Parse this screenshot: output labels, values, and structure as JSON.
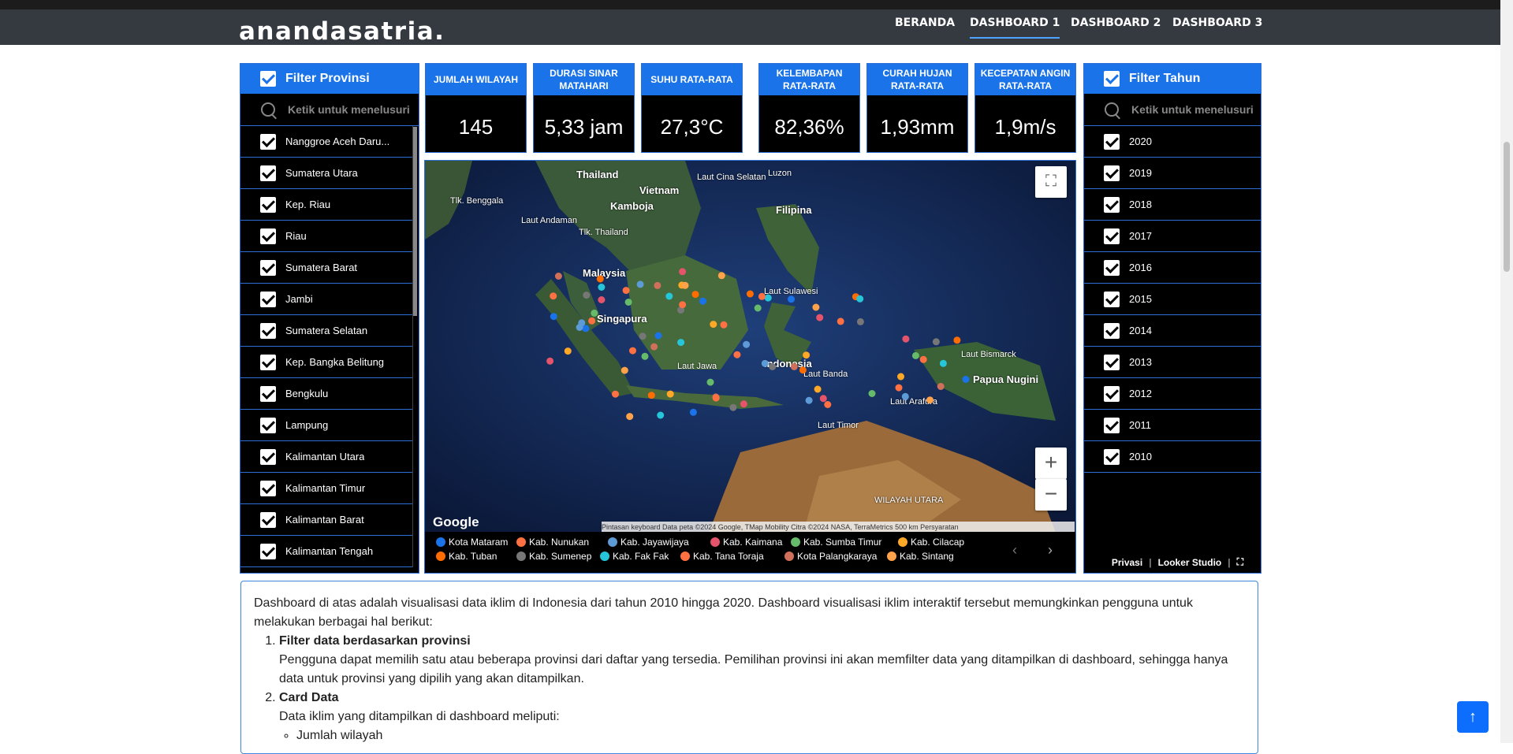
{
  "brand": "anandasatria.",
  "nav": [
    "BERANDA",
    "DASHBOARD 1",
    "DASHBOARD 2",
    "DASHBOARD 3"
  ],
  "filter_prov": {
    "title": "Filter Provinsi",
    "placeholder": "Ketik untuk menelusuri",
    "items": [
      "Nanggroe Aceh Daru...",
      "Sumatera Utara",
      "Kep. Riau",
      "Riau",
      "Sumatera Barat",
      "Jambi",
      "Sumatera Selatan",
      "Kep. Bangka Belitung",
      "Bengkulu",
      "Lampung",
      "Kalimantan Utara",
      "Kalimantan Timur",
      "Kalimantan Barat",
      "Kalimantan Tengah"
    ]
  },
  "filter_year": {
    "title": "Filter Tahun",
    "placeholder": "Ketik untuk menelusuri",
    "items": [
      "2020",
      "2019",
      "2018",
      "2017",
      "2016",
      "2015",
      "2014",
      "2013",
      "2012",
      "2011",
      "2010"
    ]
  },
  "cards": [
    {
      "label": "JUMLAH WILAYAH",
      "value": "145"
    },
    {
      "label": "DURASI SINAR MATAHARI",
      "value": "5,33 jam"
    },
    {
      "label": "SUHU RATA-RATA",
      "value": "27,3°C"
    },
    {
      "label": "KELEMBAPAN RATA-RATA",
      "value": "82,36%"
    },
    {
      "label": "CURAH HUJAN RATA-RATA",
      "value": "1,93mm"
    },
    {
      "label": "KECEPATAN ANGIN RATA-RATA",
      "value": "1,9m/s"
    }
  ],
  "map": {
    "labels": [
      "Thailand",
      "Vietnam",
      "Kamboja",
      "Laut Cina Selatan",
      "Tlk. Benggala",
      "Luzon",
      "Filipina",
      "Laut Andaman",
      "Tlk. Thailand",
      "Malaysia",
      "Singapura",
      "Laut Sulawesi",
      "Indonesia",
      "Laut Jawa",
      "Laut Banda",
      "Laut Bismarck",
      "Papua Nugini",
      "Laut Arafura",
      "Laut Timor",
      "WILAYAH UTARA"
    ],
    "google": "Google",
    "attribution": "Pintasan keyboard   Data peta ©2024 Google, TMap Mobility Citra ©2024 NASA, TerraMetrics   500 km   Persyaratan",
    "zoom_in": "+",
    "zoom_out": "−"
  },
  "legend": [
    {
      "name": "Kota Mataram",
      "color": "#1a73e8"
    },
    {
      "name": "Kab. Nunukan",
      "color": "#ff7043"
    },
    {
      "name": "Kab. Jayawijaya",
      "color": "#5c9bd6"
    },
    {
      "name": "Kab. Kaimana",
      "color": "#e5546b"
    },
    {
      "name": "Kab. Sumba Timur",
      "color": "#66bb6a"
    },
    {
      "name": "Kab. Cilacap",
      "color": "#ffa726"
    },
    {
      "name": "Kab. Tuban",
      "color": "#ff6d00"
    },
    {
      "name": "Kab. Sumenep",
      "color": "#777777"
    },
    {
      "name": "Kab. Fak Fak",
      "color": "#26c6da"
    },
    {
      "name": "Kab. Tana Toraja",
      "color": "#ff7043"
    },
    {
      "name": "Kota Palangkaraya",
      "color": "#d0705a"
    },
    {
      "name": "Kab. Sintang",
      "color": "#ffa24a"
    }
  ],
  "footer": {
    "privacy": "Privasi",
    "looker": "Looker Studio"
  },
  "description": {
    "intro": "Dashboard di atas adalah visualisasi data iklim di Indonesia dari tahun 2010 hingga 2020. Dashboard visualisasi iklim interaktif tersebut memungkinkan pengguna untuk melakukan berbagai hal berikut:",
    "item1_title": "Filter data berdasarkan provinsi",
    "item1_text": "Pengguna dapat memilih satu atau beberapa provinsi dari daftar yang tersedia. Pemilihan provinsi ini akan memfilter data yang ditampilkan di dashboard, sehingga hanya data untuk provinsi yang dipilih yang akan ditampilkan.",
    "item2_title": "Card Data",
    "item2_text": "Data iklim yang ditampilkan di dashboard meliputi:",
    "item2_sub": [
      "Jumlah wilayah"
    ]
  },
  "to_top": "↑"
}
